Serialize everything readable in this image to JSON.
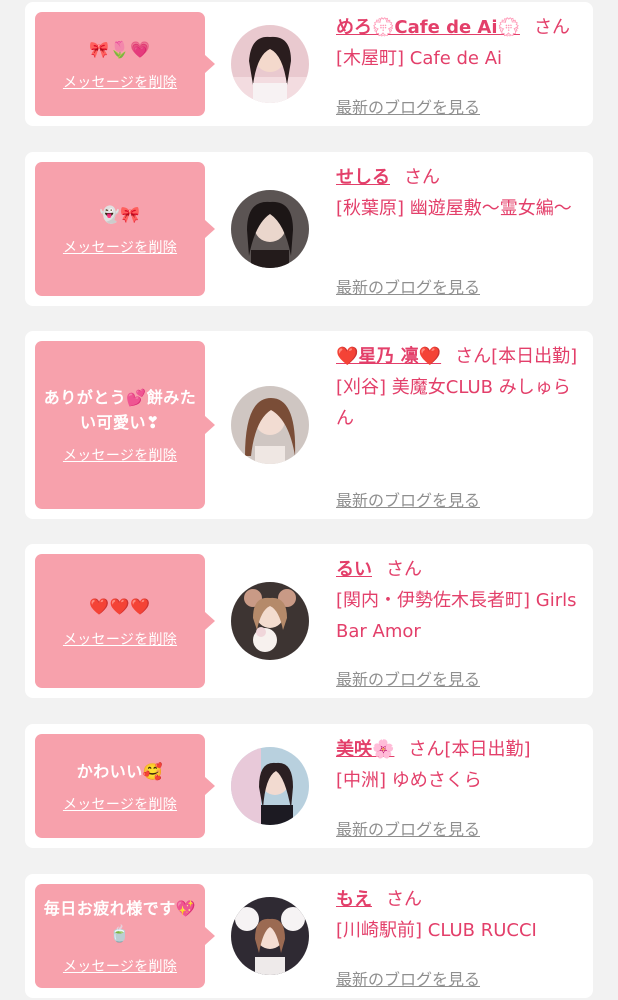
{
  "delete_label": "メッセージを削除",
  "blog_label": "最新のブログを見る",
  "items": [
    {
      "message": "🎀🌷💗",
      "name": "めろ💮Cafe de Ai💮",
      "suffix": "さん",
      "shop": "[木屋町] Cafe de Ai"
    },
    {
      "message": "👻🎀",
      "name": "せしる",
      "suffix": "さん",
      "shop": "[秋葉原] 幽遊屋敷〜霊女編〜"
    },
    {
      "message": "ありがとう💕餅みたい可愛い❣",
      "name": "❤️星乃 凛❤️",
      "suffix": "さん[本日出勤]",
      "shop": "[刈谷] 美魔女CLUB みしゅらん"
    },
    {
      "message": "❤️❤️❤️",
      "name": "るい",
      "suffix": "さん",
      "shop": "[関内・伊勢佐木長者町] Girls Bar Amor"
    },
    {
      "message": "かわいい🥰",
      "name": "美咲🌸",
      "suffix": "さん[本日出勤]",
      "shop": "[中洲] ゆめさくら"
    },
    {
      "message": "毎日お疲れ様です💖🍵",
      "name": "もえ",
      "suffix": "さん",
      "shop": "[川崎駅前] CLUB RUCCI"
    }
  ],
  "colors": {
    "accent": "#e33f6a",
    "bubble": "#f7a1ac",
    "link_gray": "#8f8f8f"
  }
}
